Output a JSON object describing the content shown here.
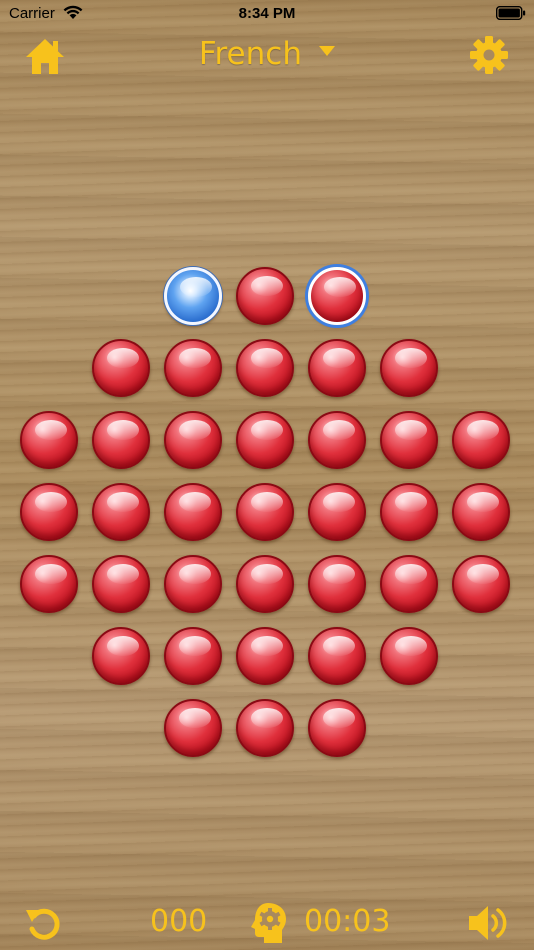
{
  "status_bar": {
    "carrier": "Carrier",
    "time": "8:34 PM",
    "icons": [
      "wifi-icon",
      "battery-icon"
    ]
  },
  "header": {
    "home_icon": "home-icon",
    "variant": "French",
    "variant_dropdown_icon": "caret-down-icon",
    "settings_icon": "gear-icon"
  },
  "board": {
    "variant": "French",
    "layout": [
      "..OOO..",
      ".OOOOO.",
      "OOOOOOO",
      "OOOOOOO",
      "OOOOOOO",
      ".OOOOO.",
      "..OOO.."
    ],
    "empty_holes": [
      [
        0,
        2
      ]
    ],
    "selected_peg": [
      0,
      4
    ],
    "peg_color": "#dd2a36",
    "empty_color": "#3f86e6",
    "pegs_remaining": 36
  },
  "footer": {
    "undo_icon": "undo-icon",
    "moves": "000",
    "hint_icon": "head-gear-hint-icon",
    "timer": "00:03",
    "sound_icon": "speaker-icon"
  },
  "colors": {
    "accent": "#f7c21c",
    "wood": "#a98a5e"
  }
}
